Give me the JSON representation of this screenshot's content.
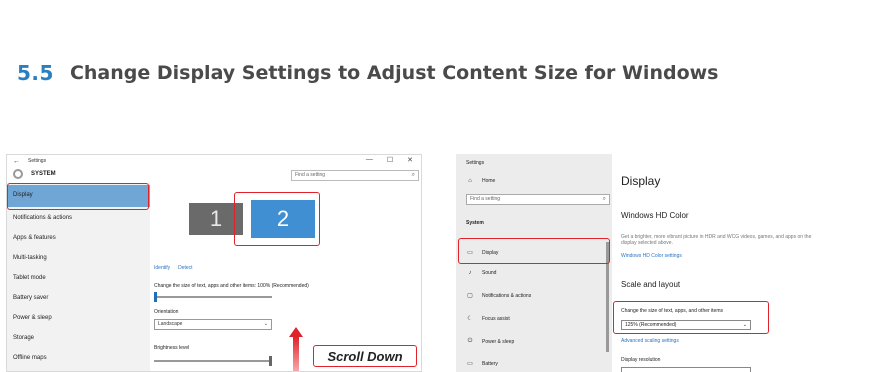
{
  "heading": {
    "number": "5.5",
    "title": "Change Display Settings to Adjust Content Size for Windows"
  },
  "left_screenshot": {
    "back_glyph": "←",
    "app_title": "Settings",
    "window_controls": [
      "—",
      "☐",
      "✕"
    ],
    "section_title": "SYSTEM",
    "search_placeholder": "Find a setting",
    "sidebar_items": [
      "Display",
      "Notifications & actions",
      "Apps & features",
      "Multi-tasking",
      "Tablet mode",
      "Battery saver",
      "Power & sleep",
      "Storage",
      "Offline maps"
    ],
    "monitors": [
      "1",
      "2"
    ],
    "identify_link": "Identify",
    "detect_link": "Detect",
    "scale_label": "Change the size of text, apps and other items: 100% (Recommended)",
    "orientation_label": "Orientation",
    "orientation_value": "Landscape",
    "brightness_label": "Brightness level",
    "scroll_callout": "Scroll Down"
  },
  "right_screenshot": {
    "app_title": "Settings",
    "home_label": "Home",
    "search_placeholder": "Find a setting",
    "section_title": "System",
    "nav_items": [
      {
        "label": "Display",
        "icon": "monitor-icon"
      },
      {
        "label": "Sound",
        "icon": "speaker-icon"
      },
      {
        "label": "Notifications & actions",
        "icon": "notifications-icon"
      },
      {
        "label": "Focus assist",
        "icon": "moon-icon"
      },
      {
        "label": "Power & sleep",
        "icon": "power-icon"
      },
      {
        "label": "Battery",
        "icon": "battery-icon"
      }
    ],
    "page_title": "Display",
    "hd_color_title": "Windows HD Color",
    "hd_color_desc": "Get a brighter, more vibrant picture in HDR and WCG videos, games, and apps on the display selected above.",
    "hd_color_link": "Windows HD Color settings",
    "scale_layout_title": "Scale and layout",
    "scale_label": "Change the size of text, apps, and other items",
    "scale_value": "125% (Recommended)",
    "advanced_link": "Advanced scaling settings",
    "resolution_label": "Display resolution"
  },
  "colors": {
    "accent": "#2a7fc0",
    "highlight": "#e0232b",
    "sidebar_active": "#6fa6d6",
    "monitor_primary": "#3f8fd2",
    "monitor_secondary": "#6a6a6a"
  }
}
